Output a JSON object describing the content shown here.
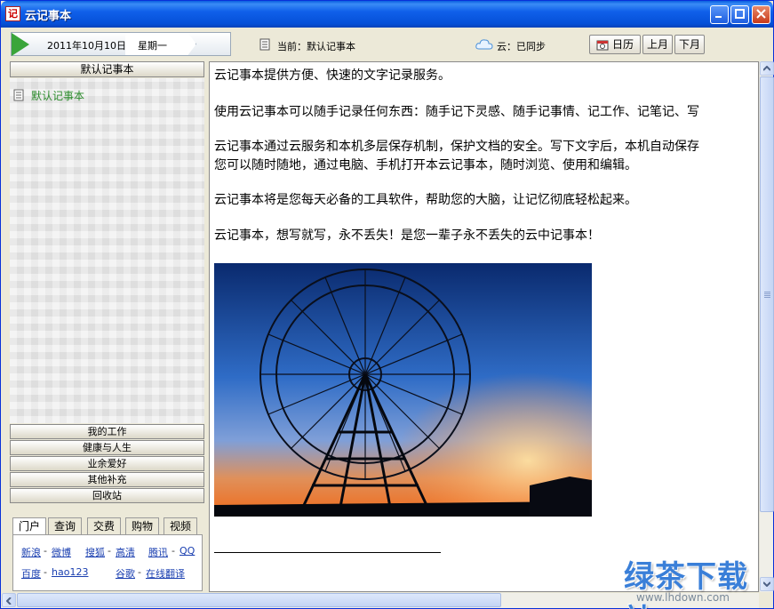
{
  "window": {
    "title": "云记事本"
  },
  "toolbar": {
    "date": "2011年10月10日",
    "weekday": "星期一",
    "current_notebook": "当前：默认记事本",
    "cloud_status": "云：已同步",
    "calendar_label": "日历",
    "prev_month_label": "上月",
    "next_month_label": "下月"
  },
  "sidebar": {
    "header": "默认记事本",
    "notebooks": [
      "默认记事本"
    ],
    "categories": [
      "我的工作",
      "健康与人生",
      "业余爱好",
      "其他补充",
      "回收站"
    ],
    "tabs": [
      "门户",
      "查询",
      "交费",
      "购物",
      "视频"
    ],
    "links": {
      "row1": [
        "新浪",
        "微博",
        "搜狐",
        "高清",
        "腾讯",
        "QQ"
      ],
      "row2": [
        "百度",
        "hao123",
        "谷歌",
        "在线翻译"
      ]
    }
  },
  "editor": {
    "paragraphs": [
      "云记事本提供方便、快速的文字记录服务。",
      "使用云记事本可以随手记录任何东西：随手记下灵感、随手记事情、记工作、记笔记、写",
      "云记事本通过云服务和本机多层保存机制，保护文档的安全。写下文字后，本机自动保存",
      "您可以随时随地，通过电脑、手机打开本云记事本，随时浏览、使用和编辑。",
      "云记事本将是您每天必备的工具软件，帮助您的大脑，让记忆彻底轻松起来。",
      "云记事本，想写就写，永不丢失！是您一辈子永不丢失的云中记事本！"
    ]
  },
  "watermark": {
    "main": "绿茶下载站",
    "sub": "www.lhdown.com"
  },
  "colors": {
    "title_bar": "#0550d8",
    "notebook_green": "#2a8a2a",
    "link_blue": "#1a3fb0"
  }
}
